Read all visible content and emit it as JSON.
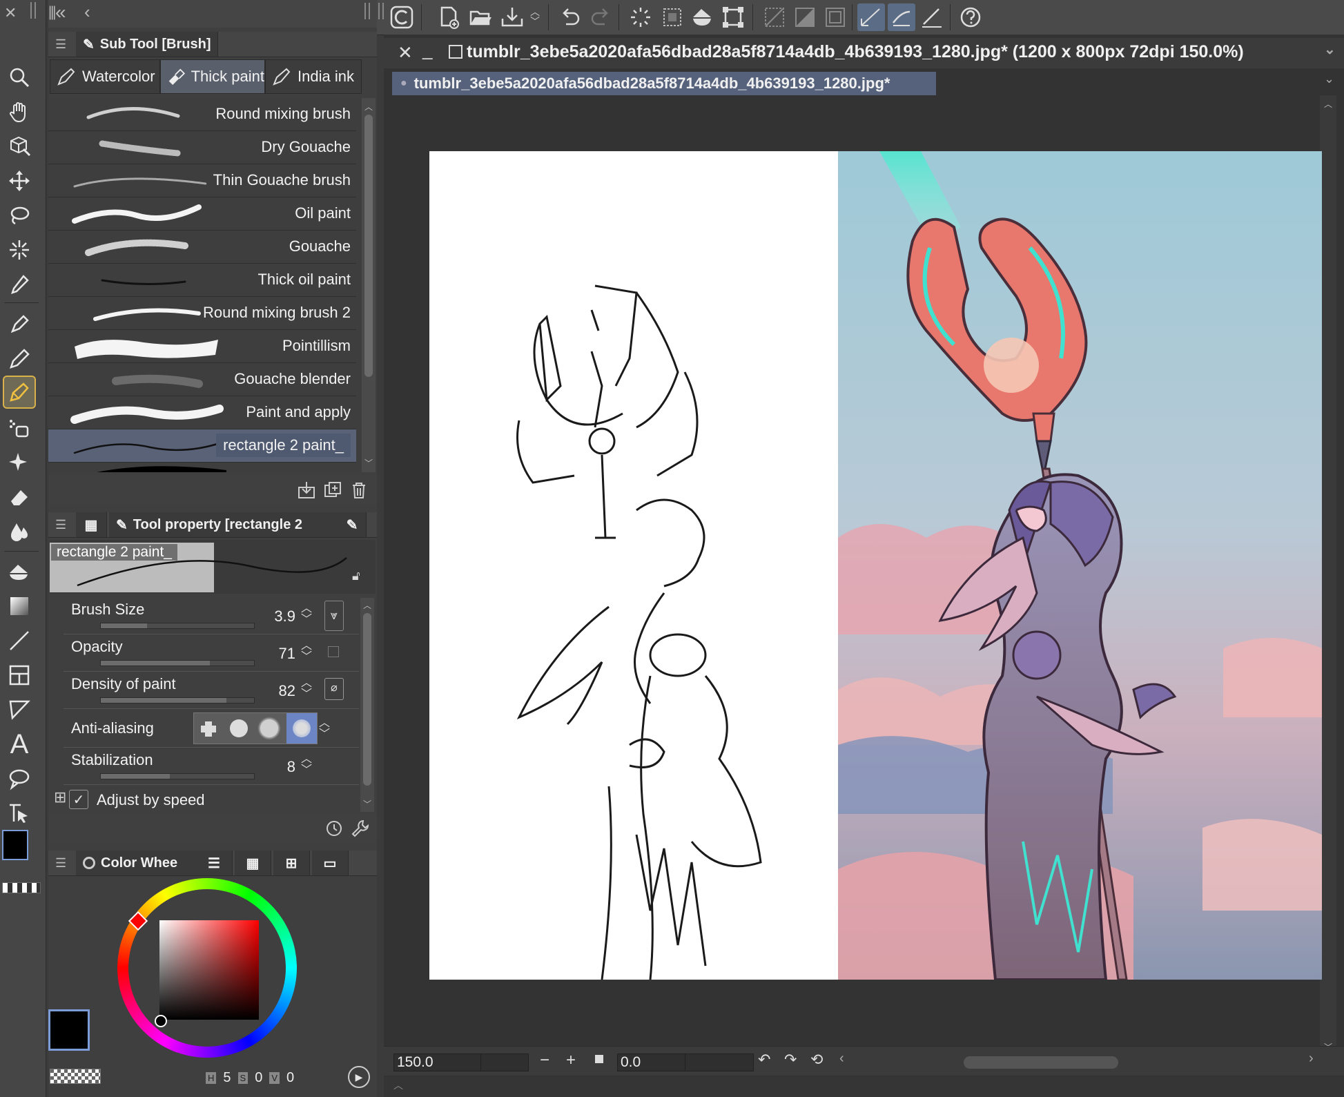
{
  "leftbar": {
    "collapse_label": "«",
    "tools": [
      "zoom-icon",
      "hand-icon",
      "3d-object-icon",
      "move-icon",
      "lasso-selection-icon",
      "auto-select-icon",
      "eyedropper-icon",
      "pen-icon",
      "pencil-icon",
      "brush-icon",
      "airbrush-icon",
      "decoration-icon",
      "eraser-icon",
      "blend-icon",
      "fill-icon",
      "gradient-icon",
      "figure-icon",
      "frame-border-icon",
      "ruler-icon",
      "text-icon",
      "balloon-icon",
      "correct-line-icon"
    ],
    "active_tool": "brush-icon",
    "main_color": "#000000",
    "sub_color": "#9a9a9a"
  },
  "subtool_panel": {
    "tab_label": "Sub Tool [Brush]",
    "groups": [
      {
        "label": "Watercolor",
        "icon": "watercolor-brush-icon"
      },
      {
        "label": "Thick paint",
        "icon": "thick-paint-icon"
      },
      {
        "label": "India ink",
        "icon": "india-ink-icon"
      }
    ],
    "active_group": "Thick paint",
    "brushes": [
      {
        "name": "Round mixing brush"
      },
      {
        "name": "Dry Gouache"
      },
      {
        "name": "Thin Gouache brush"
      },
      {
        "name": "Oil paint"
      },
      {
        "name": "Gouache"
      },
      {
        "name": "Thick oil paint"
      },
      {
        "name": "Round mixing brush 2"
      },
      {
        "name": "Pointillism"
      },
      {
        "name": "Gouache blender"
      },
      {
        "name": "Paint and apply"
      },
      {
        "name": "rectangle 2 paint_"
      }
    ],
    "selected_brush": "rectangle 2 paint_"
  },
  "tool_property": {
    "tab_label": "Tool property [rectangle 2",
    "preview_name": "rectangle 2 paint_",
    "props": [
      {
        "label": "Brush Size",
        "value": "3.9",
        "fill": 0.3
      },
      {
        "label": "Opacity",
        "value": "71",
        "fill": 0.71
      },
      {
        "label": "Density of paint",
        "value": "82",
        "fill": 0.82
      },
      {
        "label": "Anti-aliasing",
        "value": "",
        "fill": 0
      },
      {
        "label": "Stabilization",
        "value": "8",
        "fill": 0.45
      }
    ],
    "adjust_by_speed": {
      "label": "Adjust by speed",
      "checked": true
    }
  },
  "color_panel": {
    "tab_label": "Color Whee",
    "hue_color": "#ff0000",
    "hsv": {
      "h_label": "H",
      "h": "5",
      "s_label": "S",
      "s": "0",
      "v_label": "V",
      "v": "0"
    }
  },
  "document": {
    "title": "tumblr_3ebe5a2020afa56dbad28a5f8714a4db_4b639193_1280.jpg* (1200 x 800px 72dpi 150.0%)",
    "tab_label": "tumblr_3ebe5a2020afa56dbad28a5f8714a4db_4b639193_1280.jpg*",
    "zoom": "150.0",
    "rotation": "0.0"
  },
  "toolbar": {
    "buttons": [
      "clip-studio-icon",
      "new-icon",
      "open-icon",
      "save-icon",
      "undo-icon",
      "redo-icon",
      "clear-icon",
      "clear-outside-icon",
      "fill-selection-icon",
      "transform-icon",
      "hide-selection-icon",
      "snap-ruler-icon",
      "snap-grid-icon",
      "snap-special-icon",
      "snap-perspective-icon",
      "snap-figure-icon",
      "help-icon"
    ]
  }
}
